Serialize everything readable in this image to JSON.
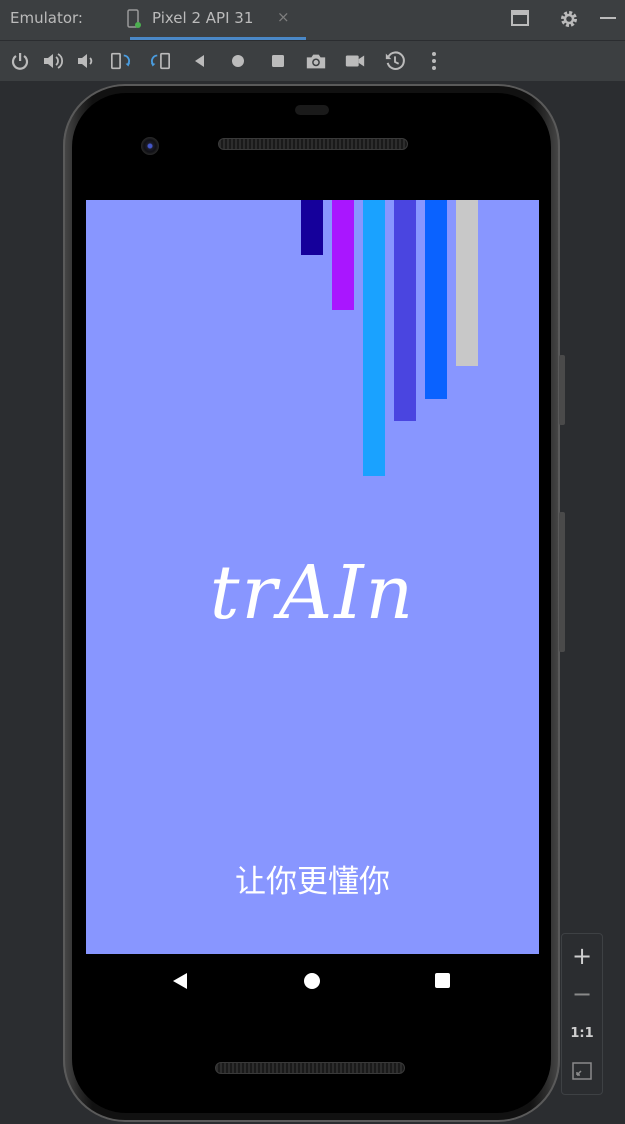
{
  "titlebar": {
    "label": "Emulator:",
    "tab_label": "Pixel 2 API 31",
    "tab_close": "×"
  },
  "toolbar": {
    "buttons": [
      "power-icon",
      "volume-up-icon",
      "volume-down-icon",
      "rotate-left-icon",
      "rotate-right-icon",
      "back-icon",
      "home-icon",
      "overview-icon",
      "screenshot-icon",
      "screen-record-icon",
      "snapshot-icon",
      "more-icon"
    ]
  },
  "app": {
    "logo": "trAIn",
    "slogan": "让你更懂你",
    "background": "#8896ff"
  },
  "colors": {
    "accent": "#4a88c7",
    "bars": [
      "#15009b",
      "#a916ff",
      "#1aa2ff",
      "#4a45e0",
      "#0a62ff",
      "#c8c8c8"
    ]
  },
  "zoom": {
    "zoom_in": "+",
    "zoom_out": "−",
    "one_to_one": "1:1"
  }
}
